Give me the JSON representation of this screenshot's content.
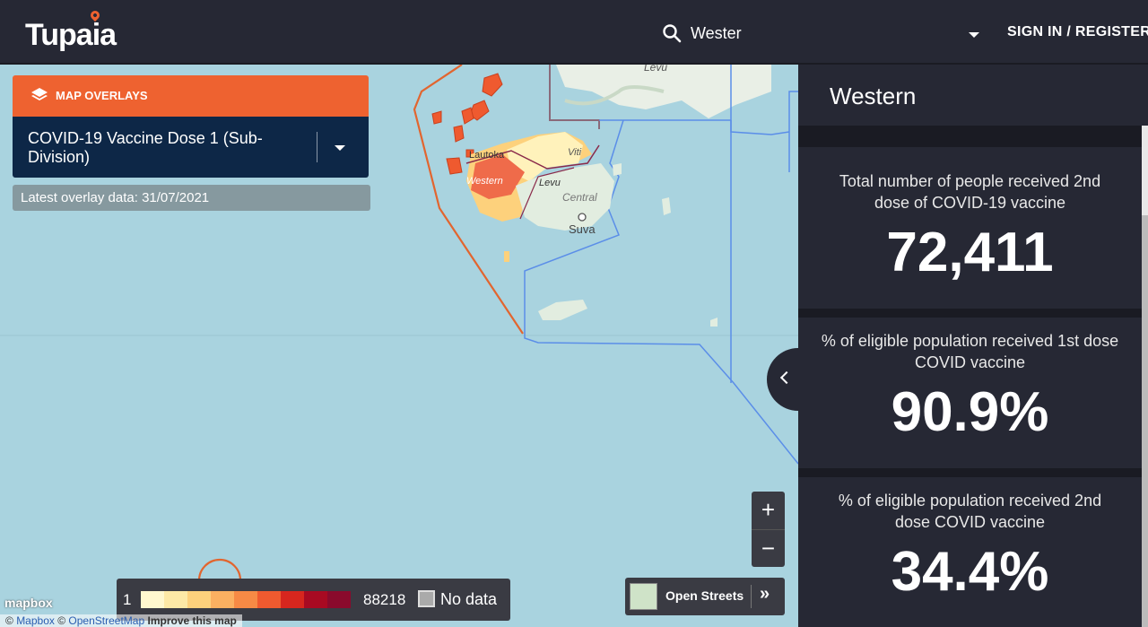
{
  "header": {
    "logo": "Tupaia",
    "search_value": "Wester",
    "signin": "SIGN IN / REGISTER"
  },
  "overlay": {
    "header_label": "MAP OVERLAYS",
    "selected": "COVID-19 Vaccine Dose 1 (Sub-Division)",
    "latest_data": "Latest overlay data: 31/07/2021"
  },
  "map_labels": {
    "levu_north": "Levu",
    "lautoka": "Lautoka",
    "western": "Western",
    "viti": "Viti",
    "levu": "Levu",
    "central": "Central",
    "suva": "Suva"
  },
  "legend": {
    "min": "1",
    "max": "88218",
    "no_data": "No data",
    "colors": [
      "#fff8cf",
      "#fde9a6",
      "#fdd17c",
      "#fbb061",
      "#f78a45",
      "#ef5a2f",
      "#d7261e",
      "#a80a22",
      "#8a0a2c"
    ]
  },
  "controls": {
    "zoom_in": "+",
    "zoom_out": "−",
    "basemap_label": "Open Streets",
    "basemap_next": "»"
  },
  "attribution": {
    "mapbox_logo": "mapbox",
    "mapbox": "Mapbox",
    "copyright": "©",
    "osm": "OpenStreetMap",
    "improve": "Improve this map"
  },
  "sidebar": {
    "title": "Western",
    "cards": [
      {
        "label": "Total number of people received 2nd dose of COVID-19 vaccine",
        "value": "72,411"
      },
      {
        "label": "% of eligible population received 1st dose COVID vaccine",
        "value": "90.9%"
      },
      {
        "label": "% of eligible population received 2nd dose COVID vaccine",
        "value": "34.4%"
      }
    ]
  },
  "colors": {
    "header_bg": "#262834",
    "accent": "#ee6230",
    "overlay_select_bg": "#0d2747",
    "sea": "#a9d3df"
  }
}
